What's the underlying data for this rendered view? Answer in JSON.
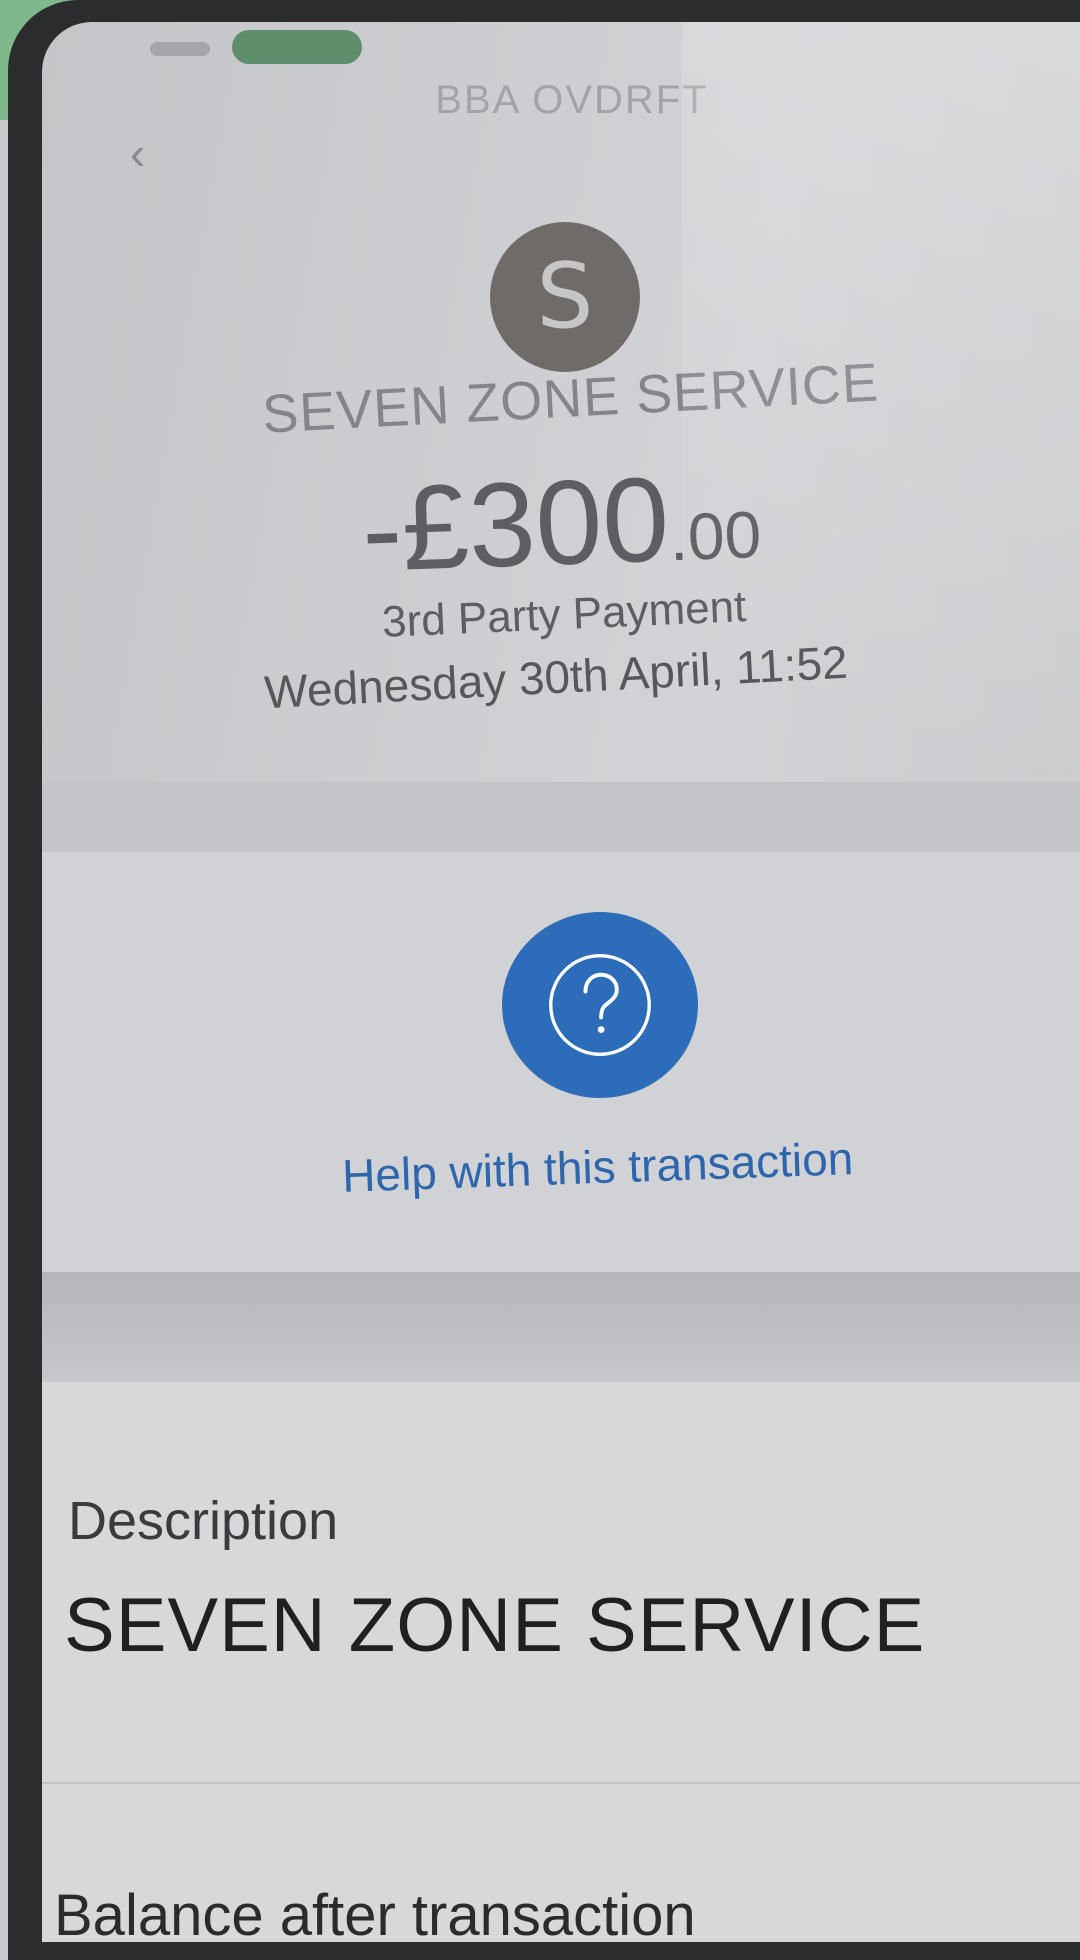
{
  "header": {
    "account_name": "BBA OVDRFT",
    "back_icon": "chevron-left-icon"
  },
  "transaction": {
    "avatar_letter": "S",
    "merchant": "SEVEN ZONE SERVICE",
    "amount_main": "-£300",
    "amount_pence": ".00",
    "type": "3rd Party Payment",
    "datetime": "Wednesday 30th April, 11:52"
  },
  "help": {
    "icon": "question-icon",
    "label": "Help with this transaction",
    "accent_color": "#2c6cb8"
  },
  "details": {
    "description_label": "Description",
    "description_value": "SEVEN ZONE SERVICE",
    "balance_label": "Balance after transaction"
  }
}
